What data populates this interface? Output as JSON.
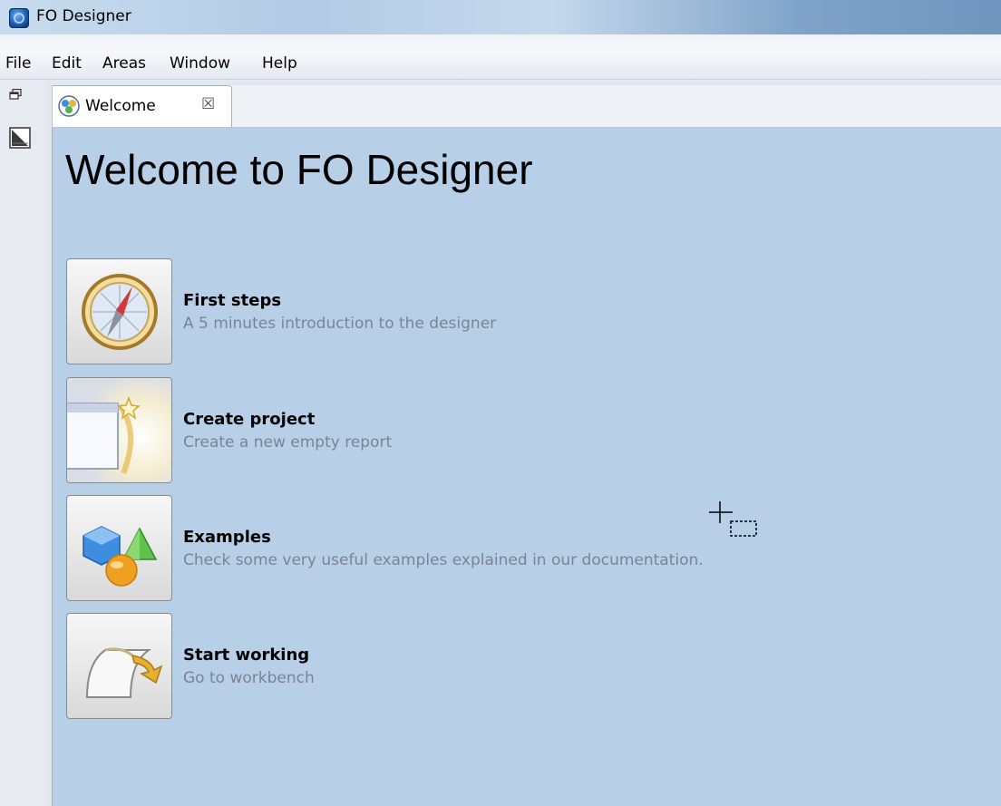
{
  "window": {
    "title": "FO Designer"
  },
  "menu": {
    "items": [
      "File",
      "Edit",
      "Areas",
      "Window",
      "Help"
    ]
  },
  "tabs": [
    {
      "label": "Welcome",
      "close_glyph": "☒"
    }
  ],
  "welcome": {
    "title": "Welcome to FO Designer",
    "actions": [
      {
        "title": "First steps",
        "description": "A 5 minutes introduction to the designer",
        "icon": "compass-icon"
      },
      {
        "title": "Create project",
        "description": "Create a new empty report",
        "icon": "new-project-icon"
      },
      {
        "title": "Examples",
        "description": "Check some very useful examples explained in our documentation.",
        "icon": "examples-icon"
      },
      {
        "title": "Start working",
        "description": "Go to workbench",
        "icon": "workbench-icon"
      }
    ]
  },
  "colors": {
    "content_background": "#b8cfe8",
    "description_text": "#7a8493"
  }
}
